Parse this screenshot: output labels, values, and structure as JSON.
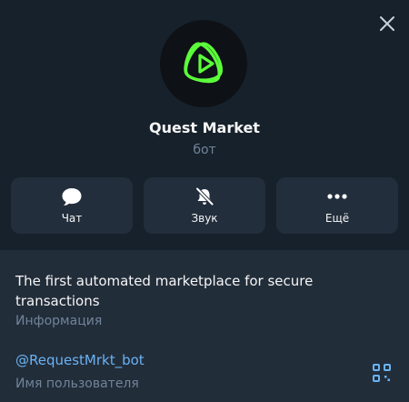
{
  "profile": {
    "name": "Quest Market",
    "subtitle": "бот",
    "avatar_icon": "atom-logo-icon",
    "accent_color": "#5bff3a"
  },
  "actions": [
    {
      "icon": "chat-bubble-icon",
      "label": "Чат"
    },
    {
      "icon": "bell-muted-icon",
      "label": "Звук"
    },
    {
      "icon": "more-dots-icon",
      "label": "Ещё"
    }
  ],
  "info": {
    "description": "The first automated marketplace for secure transactions",
    "description_label": "Информация",
    "username": "@RequestMrkt_bot",
    "username_label": "Имя пользователя",
    "qr_icon": "qr-code-icon"
  },
  "colors": {
    "background": "#17212b",
    "panel": "#222d3a",
    "button": "#232e3c",
    "muted": "#708499",
    "link": "#6ab3f3"
  }
}
